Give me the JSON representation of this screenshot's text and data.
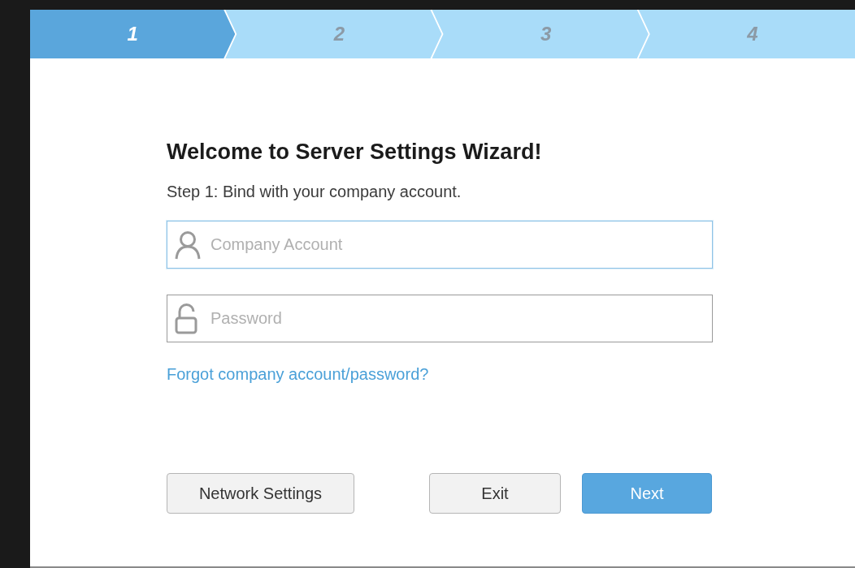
{
  "steps": [
    {
      "label": "1",
      "selected": true
    },
    {
      "label": "2",
      "selected": false
    },
    {
      "label": "3",
      "selected": false
    },
    {
      "label": "4",
      "selected": false
    }
  ],
  "title": "Welcome to Server Settings Wizard!",
  "subtitle": "Step 1: Bind with your company account.",
  "fields": [
    {
      "kind": "account",
      "placeholder": "Company Account",
      "focused": true
    },
    {
      "kind": "password",
      "placeholder": "Password",
      "focused": false
    }
  ],
  "link": "Forgot company account/password?",
  "buttons": [
    {
      "label": "Network Settings",
      "primary": false
    },
    {
      "label": "Exit",
      "primary": false
    },
    {
      "label": "Next",
      "primary": true
    }
  ]
}
